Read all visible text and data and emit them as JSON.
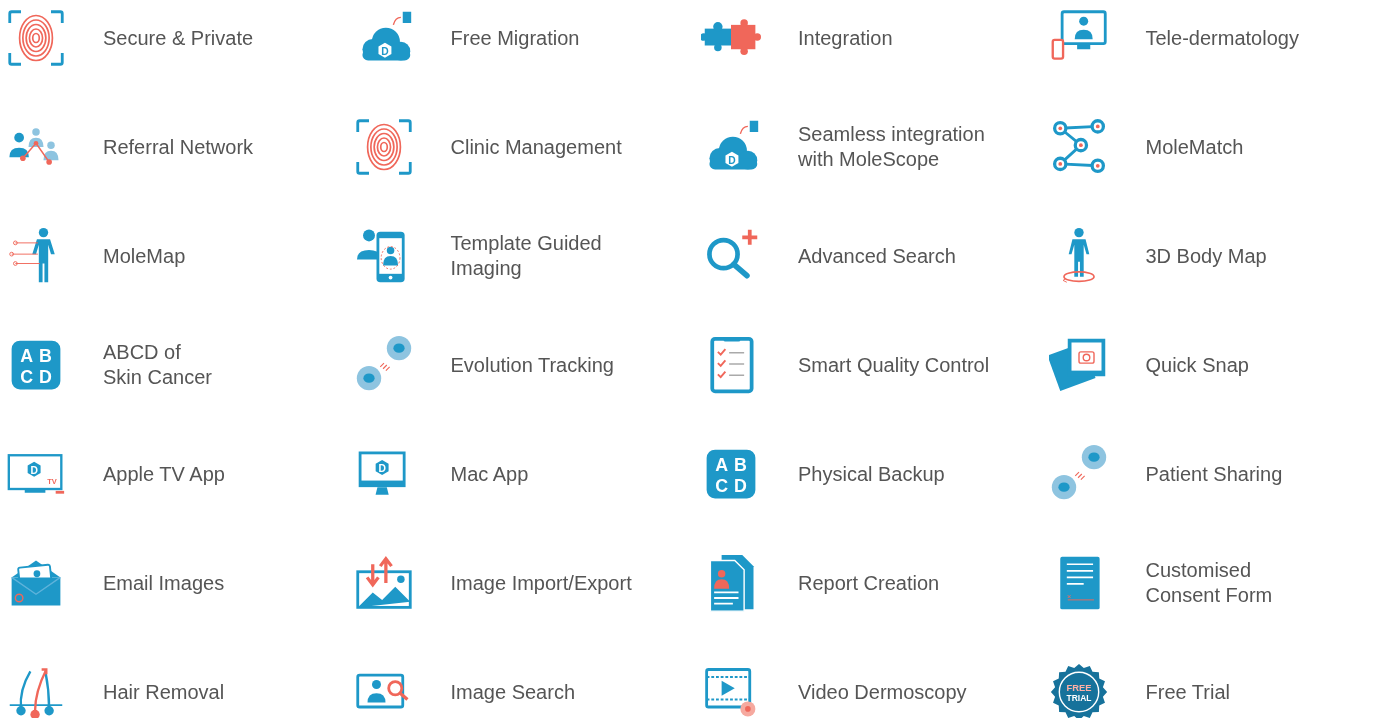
{
  "features": [
    {
      "label": "Secure & Private",
      "kind": "fingerprint"
    },
    {
      "label": "Free Migration",
      "kind": "cloud",
      "icon_text": [
        "D"
      ]
    },
    {
      "label": "Integration",
      "kind": "puzzle"
    },
    {
      "label": "Tele-dermatology",
      "kind": "telemonitor"
    },
    {
      "label": "Referral Network",
      "kind": "doctors"
    },
    {
      "label": "Clinic Management",
      "kind": "fingerprint"
    },
    {
      "label": "Seamless integration\nwith MoleScope",
      "kind": "cloud",
      "icon_text": [
        "D"
      ]
    },
    {
      "label": "MoleMatch",
      "kind": "molematch"
    },
    {
      "label": "MoleMap",
      "kind": "bodymap"
    },
    {
      "label": "Template Guided\nImaging",
      "kind": "phone"
    },
    {
      "label": "Advanced Search",
      "kind": "searchplus"
    },
    {
      "label": "3D Body Map",
      "kind": "bodyrotate"
    },
    {
      "label": "ABCD of\nSkin Cancer",
      "kind": "abcd",
      "icon_text": [
        "A",
        "B",
        "C",
        "D"
      ]
    },
    {
      "label": "Evolution Tracking",
      "kind": "moles"
    },
    {
      "label": "Smart Quality Control",
      "kind": "clipboard"
    },
    {
      "label": "Quick Snap",
      "kind": "photos"
    },
    {
      "label": "Apple TV App",
      "kind": "tv",
      "icon_text": [
        "D",
        "TV"
      ]
    },
    {
      "label": "Mac App",
      "kind": "monitor",
      "icon_text": [
        "D"
      ]
    },
    {
      "label": "Physical Backup",
      "kind": "abcd",
      "icon_text": [
        "A",
        "B",
        "C",
        "D"
      ]
    },
    {
      "label": "Patient Sharing",
      "kind": "moles"
    },
    {
      "label": "Email Images",
      "kind": "envelope"
    },
    {
      "label": "Image Import/Export",
      "kind": "imagearrows"
    },
    {
      "label": "Report Creation",
      "kind": "report"
    },
    {
      "label": "Customised\nConsent Form",
      "kind": "form"
    },
    {
      "label": "Hair Removal",
      "kind": "hair"
    },
    {
      "label": "Image Search",
      "kind": "imagesearch"
    },
    {
      "label": "Video Dermoscopy",
      "kind": "video"
    },
    {
      "label": "Free Trial",
      "kind": "seal",
      "icon_text": [
        "FREE",
        "TRIAL"
      ]
    }
  ]
}
